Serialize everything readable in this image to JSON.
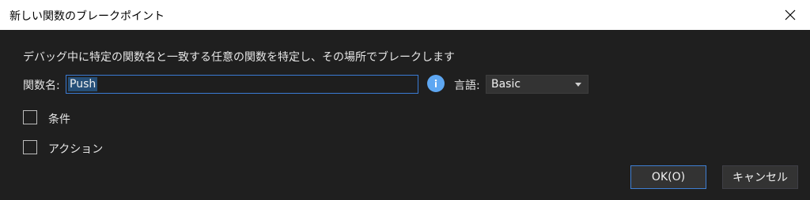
{
  "window": {
    "title": "新しい関数のブレークポイント"
  },
  "dialog": {
    "description": "デバッグ中に特定の関数名と一致する任意の関数を特定し、その場所でブレークします",
    "function_label": "関数名:",
    "function_value": "Push",
    "language_label": "言語:",
    "language_value": "Basic",
    "condition_label": "条件",
    "action_label": "アクション",
    "ok_label": "OK(O)",
    "cancel_label": "キャンセル"
  },
  "icons": [
    "close-icon",
    "info-icon",
    "chevron-down-icon"
  ]
}
